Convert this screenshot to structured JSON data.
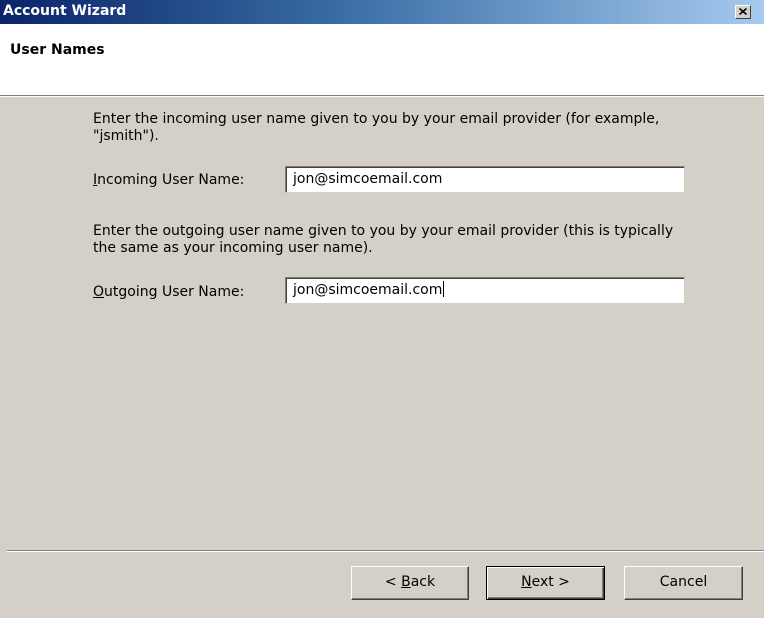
{
  "window": {
    "title": "Account Wizard",
    "close_icon": "close-icon"
  },
  "header": {
    "title": "User Names"
  },
  "incoming": {
    "instructions": "Enter the incoming user name given to you by your email provider (for example, \"jsmith\").",
    "label_mnemonic": "I",
    "label_rest": "ncoming User Name:",
    "value": "jon@simcoemail.com"
  },
  "outgoing": {
    "instructions": "Enter the outgoing user name given to you by your email provider (this is typically the same as your incoming user name).",
    "label_mnemonic": "O",
    "label_rest": "utgoing User Name:",
    "value": "jon@simcoemail.com"
  },
  "buttons": {
    "back_prefix": "< ",
    "back_mnemonic": "B",
    "back_rest": "ack",
    "next_mnemonic": "N",
    "next_rest": "ext >",
    "cancel": "Cancel"
  },
  "colors": {
    "titlebar_start": "#0a246a",
    "titlebar_end": "#a6caf0",
    "dialog_face": "#d4d0c8"
  }
}
